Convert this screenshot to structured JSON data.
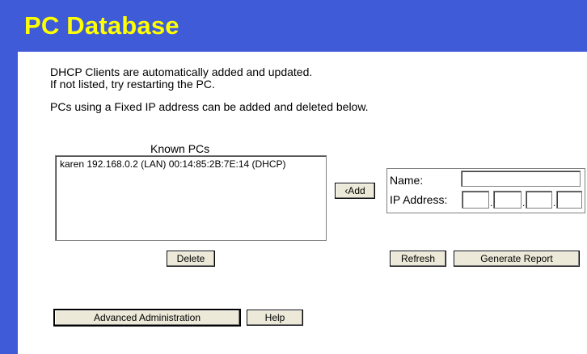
{
  "header": {
    "title": "PC Database"
  },
  "intro": {
    "line1": "DHCP Clients are automatically added and updated.",
    "line2": "If not listed, try restarting the PC.",
    "line3": "PCs using a Fixed IP address can be added and deleted below."
  },
  "known_pcs": {
    "label": "Known PCs",
    "items": [
      "karen 192.168.0.2 (LAN) 00:14:85:2B:7E:14 (DHCP)"
    ]
  },
  "buttons": {
    "add": "‹Add",
    "delete": "Delete",
    "refresh": "Refresh",
    "generate_report": "Generate Report",
    "advanced_admin": "Advanced Administration",
    "help": "Help"
  },
  "entry": {
    "name_label": "Name:",
    "ip_label": "IP Address:",
    "name_value": "",
    "ip_octets": [
      "",
      "",
      "",
      ""
    ],
    "ip_separator": "."
  },
  "colors": {
    "header_bg": "#3f5bd8",
    "title": "#ffff00"
  }
}
